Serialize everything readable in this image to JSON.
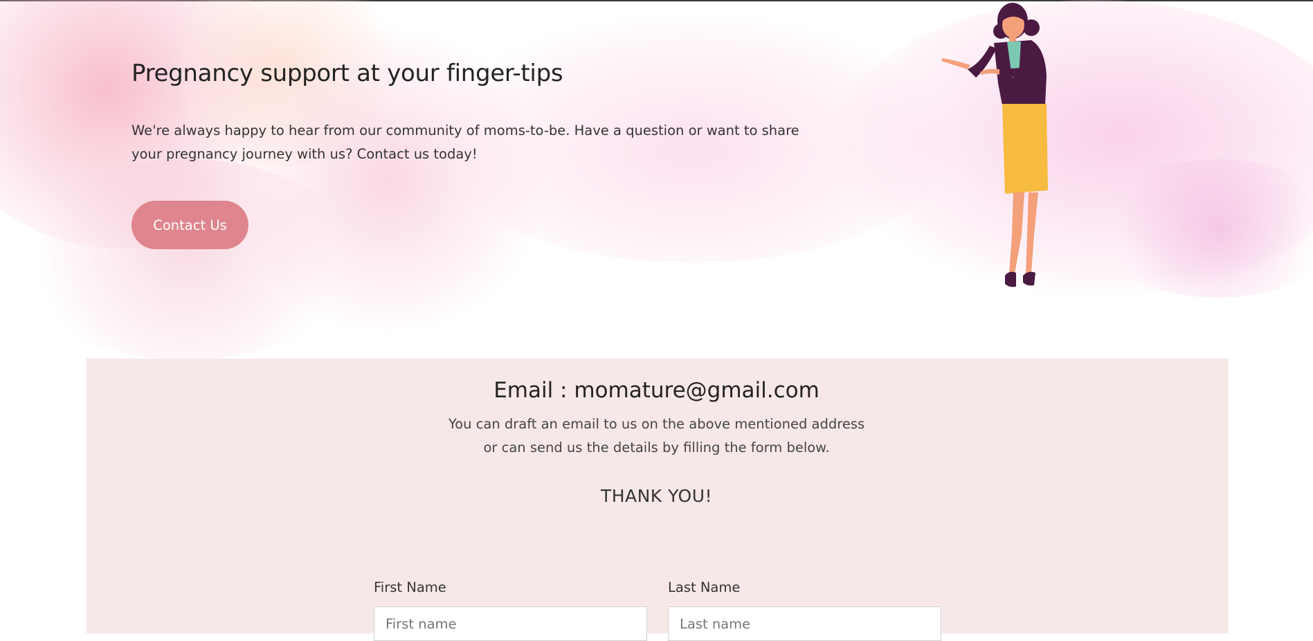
{
  "hero": {
    "title": "Pregnancy support at your finger-tips",
    "text": "We're always happy to hear from our community of moms-to-be. Have a question or want to share your pregnancy journey with us? Contact us today!",
    "button_label": "Contact Us"
  },
  "contact": {
    "email_heading": "Email : momature@gmail.com",
    "desc_line1": "You can draft an email to us on the above mentioned address",
    "desc_line2": "or can send us the details by filling the form below.",
    "thanks": "THANK YOU!"
  },
  "form": {
    "first_name_label": "First Name",
    "first_name_placeholder": "First name",
    "last_name_label": "Last Name",
    "last_name_placeholder": "Last name"
  },
  "colors": {
    "button": "#df858e",
    "card_bg": "#f7e8e8",
    "jacket": "#4a1a42",
    "skirt": "#f6bb3f"
  }
}
